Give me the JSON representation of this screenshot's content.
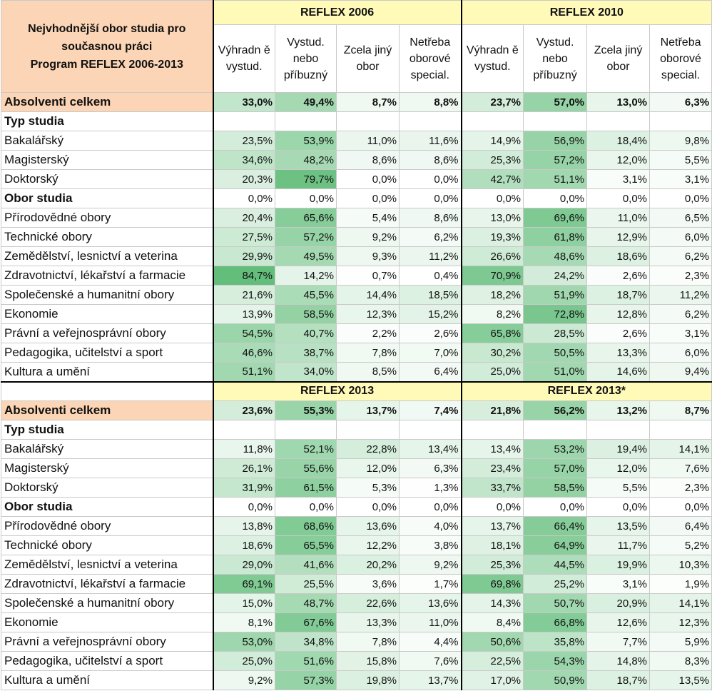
{
  "colors": {
    "heat_max": "#63be7b",
    "heat_min": "#ffffff",
    "total_label_bg": "#fbd5b5",
    "year_header_bg": "#fffab8"
  },
  "header": {
    "corner_line1": "Nejvhodnější obor studia pro",
    "corner_line2": "současnou práci",
    "corner_line3": "Program REFLEX 2006-2013",
    "columns": [
      "Výhradn ě vystud.",
      "Vystud. nebo příbuzný",
      "Zcela jiný obor",
      "Netřeba oborové special."
    ]
  },
  "panels": [
    {
      "years": [
        "REFLEX 2006",
        "REFLEX 2010"
      ],
      "rows": [
        {
          "label": "Absolventi celkem",
          "kind": "total",
          "values": [
            "33,0%",
            "49,4%",
            "8,7%",
            "8,8%",
            "23,7%",
            "57,0%",
            "13,0%",
            "6,3%"
          ]
        },
        {
          "label": "Typ studia",
          "kind": "section",
          "values": [
            "",
            "",
            "",
            "",
            "",
            "",
            "",
            ""
          ]
        },
        {
          "label": "Bakalářský",
          "kind": "row",
          "values": [
            "23,5%",
            "53,9%",
            "11,0%",
            "11,6%",
            "14,9%",
            "56,9%",
            "18,4%",
            "9,8%"
          ]
        },
        {
          "label": "Magisterský",
          "kind": "row",
          "values": [
            "34,6%",
            "48,2%",
            "8,6%",
            "8,6%",
            "25,3%",
            "57,2%",
            "12,0%",
            "5,5%"
          ]
        },
        {
          "label": "Doktorský",
          "kind": "row",
          "values": [
            "20,3%",
            "79,7%",
            "0,0%",
            "0,0%",
            "42,7%",
            "51,1%",
            "3,1%",
            "3,1%"
          ]
        },
        {
          "label": "Obor studia",
          "kind": "section",
          "values": [
            "0,0%",
            "0,0%",
            "0,0%",
            "0,0%",
            "0,0%",
            "0,0%",
            "0,0%",
            "0,0%"
          ]
        },
        {
          "label": "Přírodovědné obory",
          "kind": "row",
          "values": [
            "20,4%",
            "65,6%",
            "5,4%",
            "8,6%",
            "13,0%",
            "69,6%",
            "11,0%",
            "6,5%"
          ]
        },
        {
          "label": "Technické obory",
          "kind": "row",
          "values": [
            "27,5%",
            "57,2%",
            "9,2%",
            "6,2%",
            "19,3%",
            "61,8%",
            "12,9%",
            "6,0%"
          ]
        },
        {
          "label": "Zemědělství, lesnictví a veterina",
          "kind": "row",
          "values": [
            "29,9%",
            "49,5%",
            "9,3%",
            "11,2%",
            "26,6%",
            "48,6%",
            "18,6%",
            "6,2%"
          ]
        },
        {
          "label": "Zdravotnictví, lékařství a farmacie",
          "kind": "row",
          "values": [
            "84,7%",
            "14,2%",
            "0,7%",
            "0,4%",
            "70,9%",
            "24,2%",
            "2,6%",
            "2,3%"
          ]
        },
        {
          "label": "Společenské a humanitní obory",
          "kind": "row",
          "values": [
            "21,6%",
            "45,5%",
            "14,4%",
            "18,5%",
            "18,2%",
            "51,9%",
            "18,7%",
            "11,2%"
          ]
        },
        {
          "label": "Ekonomie",
          "kind": "row",
          "values": [
            "13,9%",
            "58,5%",
            "12,3%",
            "15,2%",
            "8,2%",
            "72,8%",
            "12,8%",
            "6,2%"
          ]
        },
        {
          "label": "Právní a veřejnosprávní obory",
          "kind": "row",
          "values": [
            "54,5%",
            "40,7%",
            "2,2%",
            "2,6%",
            "65,8%",
            "28,5%",
            "2,6%",
            "3,1%"
          ]
        },
        {
          "label": "Pedagogika, učitelství a sport",
          "kind": "row",
          "values": [
            "46,6%",
            "38,7%",
            "7,8%",
            "7,0%",
            "30,2%",
            "50,5%",
            "13,3%",
            "6,0%"
          ]
        },
        {
          "label": "Kultura a umění",
          "kind": "row",
          "values": [
            "51,1%",
            "34,0%",
            "8,5%",
            "6,4%",
            "25,0%",
            "51,0%",
            "14,6%",
            "9,4%"
          ]
        }
      ]
    },
    {
      "years": [
        "REFLEX 2013",
        "REFLEX 2013*"
      ],
      "rows": [
        {
          "label": "Absolventi celkem",
          "kind": "total",
          "values": [
            "23,6%",
            "55,3%",
            "13,7%",
            "7,4%",
            "21,8%",
            "56,2%",
            "13,2%",
            "8,7%"
          ]
        },
        {
          "label": "Typ studia",
          "kind": "section",
          "values": [
            "",
            "",
            "",
            "",
            "",
            "",
            "",
            ""
          ]
        },
        {
          "label": "Bakalářský",
          "kind": "row",
          "values": [
            "11,8%",
            "52,1%",
            "22,8%",
            "13,4%",
            "13,4%",
            "53,2%",
            "19,4%",
            "14,1%"
          ]
        },
        {
          "label": "Magisterský",
          "kind": "row",
          "values": [
            "26,1%",
            "55,6%",
            "12,0%",
            "6,3%",
            "23,4%",
            "57,0%",
            "12,0%",
            "7,6%"
          ]
        },
        {
          "label": "Doktorský",
          "kind": "row",
          "values": [
            "31,9%",
            "61,5%",
            "5,3%",
            "1,3%",
            "33,7%",
            "58,5%",
            "5,5%",
            "2,3%"
          ]
        },
        {
          "label": "Obor studia",
          "kind": "section",
          "values": [
            "0,0%",
            "0,0%",
            "0,0%",
            "0,0%",
            "0,0%",
            "0,0%",
            "0,0%",
            "0,0%"
          ]
        },
        {
          "label": "Přírodovědné obory",
          "kind": "row",
          "values": [
            "13,8%",
            "68,6%",
            "13,6%",
            "4,0%",
            "13,7%",
            "66,4%",
            "13,5%",
            "6,4%"
          ]
        },
        {
          "label": "Technické obory",
          "kind": "row",
          "values": [
            "18,6%",
            "65,5%",
            "12,2%",
            "3,8%",
            "18,1%",
            "64,9%",
            "11,7%",
            "5,2%"
          ]
        },
        {
          "label": "Zemědělství, lesnictví a veterina",
          "kind": "row",
          "values": [
            "29,0%",
            "41,6%",
            "20,2%",
            "9,2%",
            "25,3%",
            "44,5%",
            "19,9%",
            "10,3%"
          ]
        },
        {
          "label": "Zdravotnictví, lékařství a farmacie",
          "kind": "row",
          "values": [
            "69,1%",
            "25,5%",
            "3,6%",
            "1,7%",
            "69,8%",
            "25,2%",
            "3,1%",
            "1,9%"
          ]
        },
        {
          "label": "Společenské a humanitní obory",
          "kind": "row",
          "values": [
            "15,0%",
            "48,7%",
            "22,6%",
            "13,6%",
            "14,3%",
            "50,7%",
            "20,9%",
            "14,1%"
          ]
        },
        {
          "label": "Ekonomie",
          "kind": "row",
          "values": [
            "8,1%",
            "67,6%",
            "13,3%",
            "11,0%",
            "8,4%",
            "66,8%",
            "12,6%",
            "12,3%"
          ]
        },
        {
          "label": "Právní a veřejnosprávní obory",
          "kind": "row",
          "values": [
            "53,0%",
            "34,8%",
            "7,8%",
            "4,4%",
            "50,6%",
            "35,8%",
            "7,7%",
            "5,9%"
          ]
        },
        {
          "label": "Pedagogika, učitelství a sport",
          "kind": "row",
          "values": [
            "25,0%",
            "51,6%",
            "15,8%",
            "7,6%",
            "22,5%",
            "54,3%",
            "14,8%",
            "8,3%"
          ]
        },
        {
          "label": "Kultura a umění",
          "kind": "row",
          "values": [
            "9,2%",
            "57,3%",
            "19,8%",
            "13,7%",
            "17,0%",
            "50,9%",
            "18,7%",
            "13,5%"
          ]
        }
      ]
    }
  ]
}
